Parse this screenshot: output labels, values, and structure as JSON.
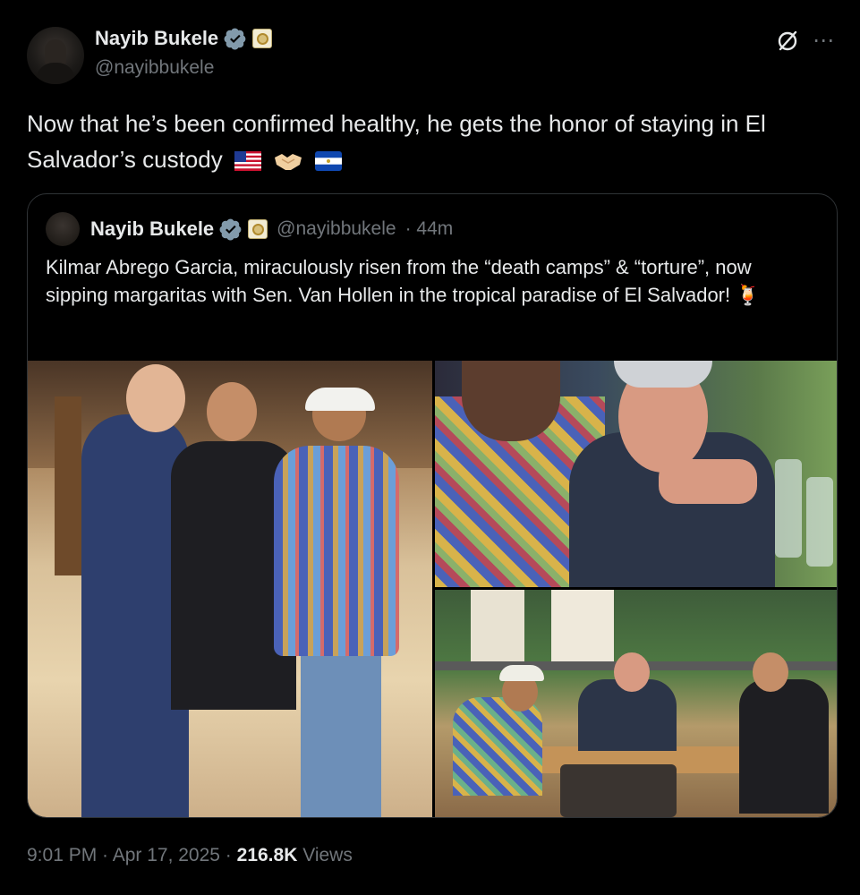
{
  "author": {
    "name": "Nayib Bukele",
    "handle": "@nayibbukele",
    "verified_icon": "verified-badge-icon",
    "affiliate_icon": "government-seal-icon"
  },
  "tweet": {
    "text": "Now that he’s been confirmed healthy, he gets the honor of staying in El Salvador’s custody",
    "emojis": [
      "us-flag",
      "handshake",
      "el-salvador-flag"
    ]
  },
  "quote": {
    "name": "Nayib Bukele",
    "handle": "@nayibbukele",
    "time": "· 44m",
    "text": "Kilmar Abrego Garcia, miraculously risen from the “death camps” & “torture”, now sipping margaritas with Sen. Van Hollen in the tropical paradise of El Salvador! 🍹",
    "photos": [
      "handshake-photo",
      "senator-closeup-photo",
      "restaurant-table-photo"
    ]
  },
  "meta": {
    "time": "9:01 PM · Apr 17, 2025 · ",
    "views_count": "216.8K",
    "views_label": " Views"
  },
  "colors": {
    "background": "#000000",
    "text": "#e7e9ea",
    "secondary": "#71767b",
    "verified": "#829aab",
    "border": "#2f3336"
  }
}
